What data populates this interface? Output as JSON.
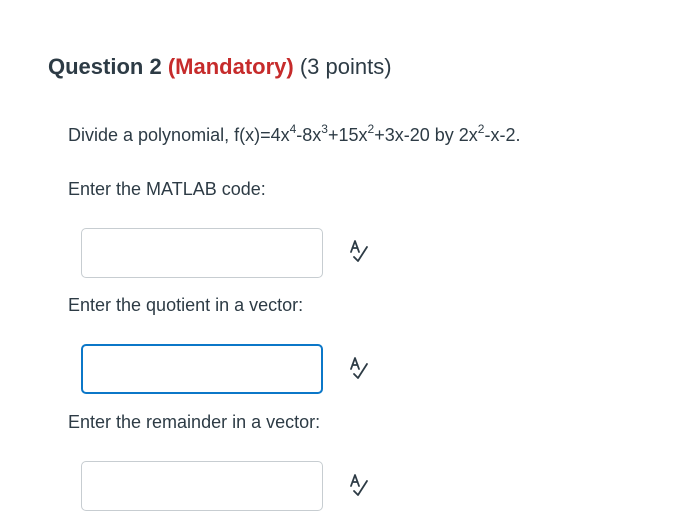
{
  "question": {
    "title": "Question 2",
    "mandatory": "(Mandatory)",
    "points": "(3 points)"
  },
  "prompt": {
    "part1": "Divide a polynomial, f(x)=4x",
    "exp1": "4",
    "part2": "-8x",
    "exp2": "3",
    "part3": "+15x",
    "exp3": "2",
    "part4": "+3x-20 by 2x",
    "exp4": "2",
    "part5": "-x-2."
  },
  "fields": [
    {
      "label": "Enter the MATLAB code:",
      "value": "",
      "icon": "spell-check-icon"
    },
    {
      "label": "Enter the quotient in a vector:",
      "value": "",
      "icon": "spell-check-icon",
      "focused": true
    },
    {
      "label": "Enter the remainder in a vector:",
      "value": "",
      "icon": "spell-check-icon"
    }
  ],
  "colors": {
    "text": "#2d3b45",
    "mandatory": "#c62b2b",
    "focus_border": "#0b77c8",
    "input_border": "#c7cdd1"
  }
}
